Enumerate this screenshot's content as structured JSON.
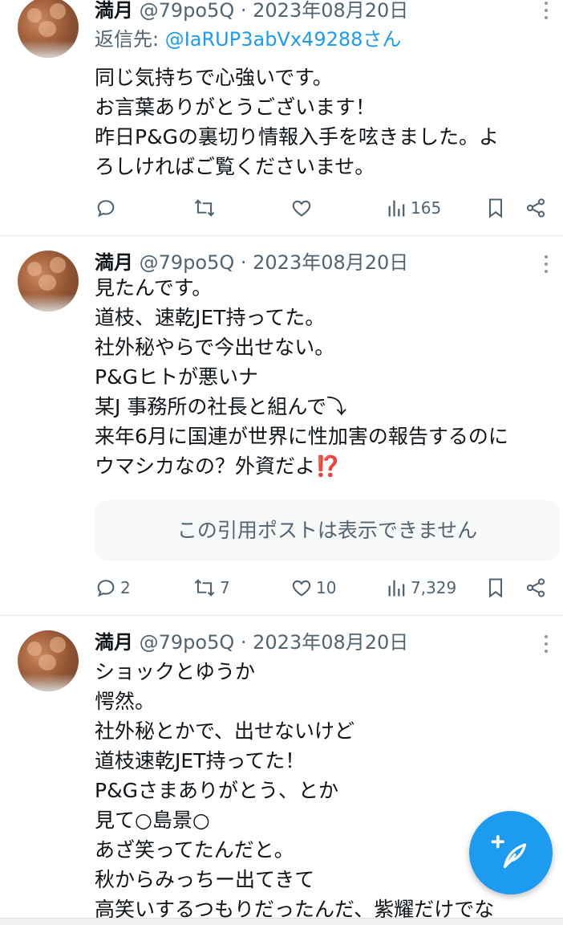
{
  "tweets": [
    {
      "name": "満月",
      "meta": "@79po5Q · 2023年08月20日",
      "reply_prefix": "返信先: ",
      "reply_handle": "@IaRUP3abVx49288さん",
      "lines": [
        "同じ気持ちで心強いです。",
        "お言葉ありがとうございます！",
        "昨日P&Gの裏切り情報入手を呟きました。よ",
        "ろしければご覧くださいませ。"
      ],
      "actions": {
        "replies": "",
        "reposts": "",
        "likes": "",
        "views": "165"
      }
    },
    {
      "name": "満月",
      "meta": "@79po5Q · 2023年08月20日",
      "lines": [
        "見たんです。",
        "道枝、速乾JET持ってた。",
        "社外秘やらで今出せない。",
        "P&Gヒトが悪いナ",
        "某J 事務所の社長と組んで⤵︎",
        "来年6月に国連が世界に性加害の報告するのに",
        "ウマシカなの？外資だよ⁉️"
      ],
      "quote": "この引用ポストは表示できません",
      "actions": {
        "replies": "2",
        "reposts": "7",
        "likes": "10",
        "views": "7,329"
      }
    },
    {
      "name": "満月",
      "meta": "@79po5Q · 2023年08月20日",
      "lines": [
        "ショックとゆうか",
        "愕然。",
        "社外秘とかで、出せないけど",
        "道枝速乾JET持ってた！",
        "P&Gさまありがとう、とか",
        "見て○島景○",
        "あざ笑ってたんだと。",
        "秋からみっちー出てきて",
        "高笑いするつもりだったんだ、紫耀だけでな"
      ]
    }
  ],
  "colors": {
    "accent": "#1d9bf0",
    "muted": "#536471",
    "text": "#0f1419"
  },
  "icons": [
    "reply-icon",
    "repost-icon",
    "like-icon",
    "views-icon",
    "bookmark-icon",
    "share-icon",
    "more-icon",
    "compose-icon"
  ]
}
